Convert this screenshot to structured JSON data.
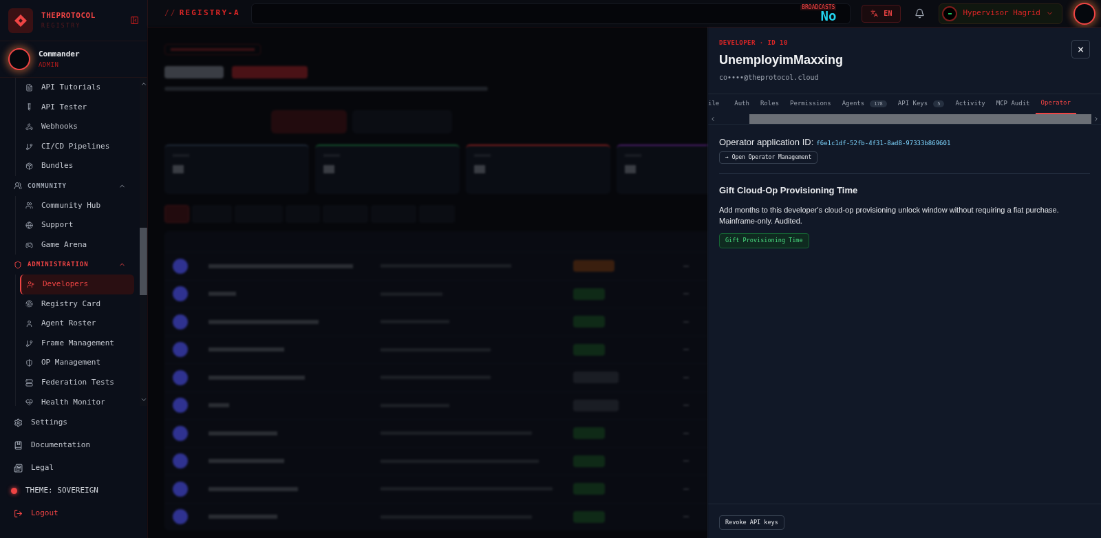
{
  "sidebar": {
    "brand": "THEPROTOCOL",
    "subtitle": "REGISTRY",
    "user": {
      "name": "Commander",
      "role": "ADMIN"
    },
    "nav": [
      {
        "items": [
          {
            "label": "API Tutorials",
            "selected": false
          },
          {
            "label": "API Tester",
            "selected": false
          },
          {
            "label": "Webhooks",
            "selected": false
          },
          {
            "label": "CI/CD Pipelines",
            "selected": false
          },
          {
            "label": "Bundles",
            "selected": false
          }
        ]
      },
      {
        "label": "COMMUNITY",
        "expanded": true,
        "items": [
          {
            "label": "Community Hub",
            "selected": false
          },
          {
            "label": "Support",
            "selected": false
          },
          {
            "label": "Game Arena",
            "selected": false
          }
        ]
      },
      {
        "label": "ADMINISTRATION",
        "expanded": true,
        "items": [
          {
            "label": "Developers",
            "selected": true
          },
          {
            "label": "Registry Card",
            "selected": false
          },
          {
            "label": "Agent Roster",
            "selected": false
          },
          {
            "label": "Frame Management",
            "selected": false
          },
          {
            "label": "OP Management",
            "selected": false
          },
          {
            "label": "Federation Tests",
            "selected": false
          },
          {
            "label": "Health Monitor",
            "selected": false
          }
        ]
      }
    ],
    "footer": [
      {
        "label": "Settings",
        "kind": "link"
      },
      {
        "label": "Documentation",
        "kind": "link"
      },
      {
        "label": "Legal",
        "kind": "link"
      },
      {
        "label": "THEME: SOVEREIGN",
        "kind": "theme"
      },
      {
        "label": "Logout",
        "kind": "danger"
      }
    ]
  },
  "topbar": {
    "prefix": "//",
    "breadcrumb": "REGISTRY-A",
    "broadcasts_label": "BROADCASTS",
    "broadcasts_value": "No",
    "language": "EN",
    "user": "Hypervisor Hagrid"
  },
  "drawer": {
    "eyebrow": "DEVELOPER · ID 10",
    "title": "UnemployimMaxxing",
    "email": "co••••@theprotocol.cloud",
    "close": "×",
    "tabs": [
      {
        "label": "ile",
        "selected": false
      },
      {
        "label": "Auth",
        "selected": false
      },
      {
        "label": "Roles",
        "selected": false
      },
      {
        "label": "Permissions",
        "selected": false
      },
      {
        "label": "Agents",
        "count": "178",
        "selected": false
      },
      {
        "label": "API Keys",
        "count": "5",
        "selected": false
      },
      {
        "label": "Activity",
        "selected": false
      },
      {
        "label": "MCP Audit",
        "selected": false
      },
      {
        "label": "Operator",
        "selected": true
      }
    ],
    "operator_label": "Operator application ID:",
    "operator_id": "f6e1c1df-52fb-4f31-8ad8-97333b869601",
    "open_button": "→ Open Operator Management",
    "gift_title": "Gift Cloud-Op Provisioning Time",
    "gift_text": "Add months to this developer's cloud-op provisioning unlock window without requiring a fiat purchase. Mainframe-only. Audited.",
    "gift_button": "Gift Provisioning Time",
    "footer_button": "Revoke API keys"
  }
}
